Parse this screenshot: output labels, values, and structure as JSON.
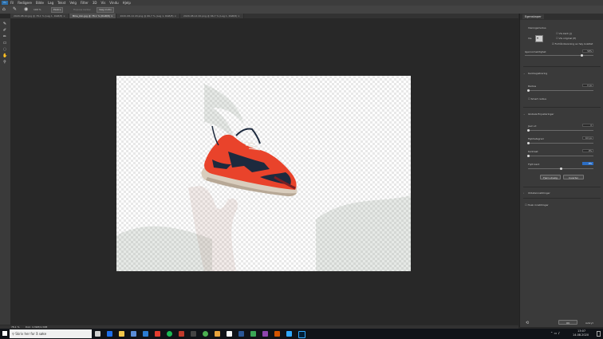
{
  "menubar": {
    "items": [
      "Fil",
      "Redigere",
      "Bilde",
      "Lag",
      "Tekst",
      "Velg",
      "Filter",
      "3D",
      "Vis",
      "Vindu",
      "Hjelp"
    ]
  },
  "options": {
    "zoom_label": "100 %",
    "mode_value": "Ekstra",
    "btn_a": "Finpuss kanter",
    "btn_b": "Velg motiv"
  },
  "tabs": [
    {
      "label": "2020-08-10.jpg @ 78,1 % (Lag 1, RGB/8)"
    },
    {
      "label": "Mike_kko.jpg @ 78,1 % (RGB/8)"
    },
    {
      "label": "2020-08-14 20.png @ 66,7 % (Lag 1, RGB/8)"
    },
    {
      "label": "2020-08-14 20.png @ 66,7 % (Lag 1, RGB/8)"
    }
  ],
  "panel": {
    "title": "Egenskaper",
    "visningsmodus": "Visningsmodus",
    "vis_label": "Vis",
    "vis_kant": "Vis kant (J)",
    "vis_original": "Vis original (P)",
    "hq_preview": "Forhåndsvisning av høy kvalitet",
    "gjennomsiktighet": "Gjennomsiktighet",
    "gjennomsiktighet_value": "50%",
    "kantregistrering": "Kantregistrering",
    "radius_label": "Radius",
    "radius_value": "0 px",
    "smart_radius": "Smart radius",
    "globale": "Globale finjusteringer",
    "jevn_label": "Jevn ut",
    "jevn_value": "0",
    "myk_label": "Mykhetsgrad",
    "myk_value": "0,0 px",
    "kontrast_label": "Kontrast",
    "kontrast_value": "0%",
    "flytt_label": "Flytt kant",
    "flytt_value": "0%",
    "fjern_btn": "Fjern utvalg",
    "inverter_btn": "Inverter",
    "utdata": "Utdatainnstillinger",
    "husk": "Husk innstillinger",
    "ok": "OK",
    "avbryt": "Avbryt"
  },
  "status": {
    "zoom": "78,1 %",
    "doc": "Dok: 4,39M/4,39M"
  },
  "taskbar": {
    "search_placeholder": "Skriv her for å søke",
    "time": "13:07",
    "date": "14.08.2020"
  },
  "colors": {
    "accent": "#2c6ec4",
    "shoe_red": "#e9432b",
    "shoe_navy": "#1d2a3e"
  }
}
